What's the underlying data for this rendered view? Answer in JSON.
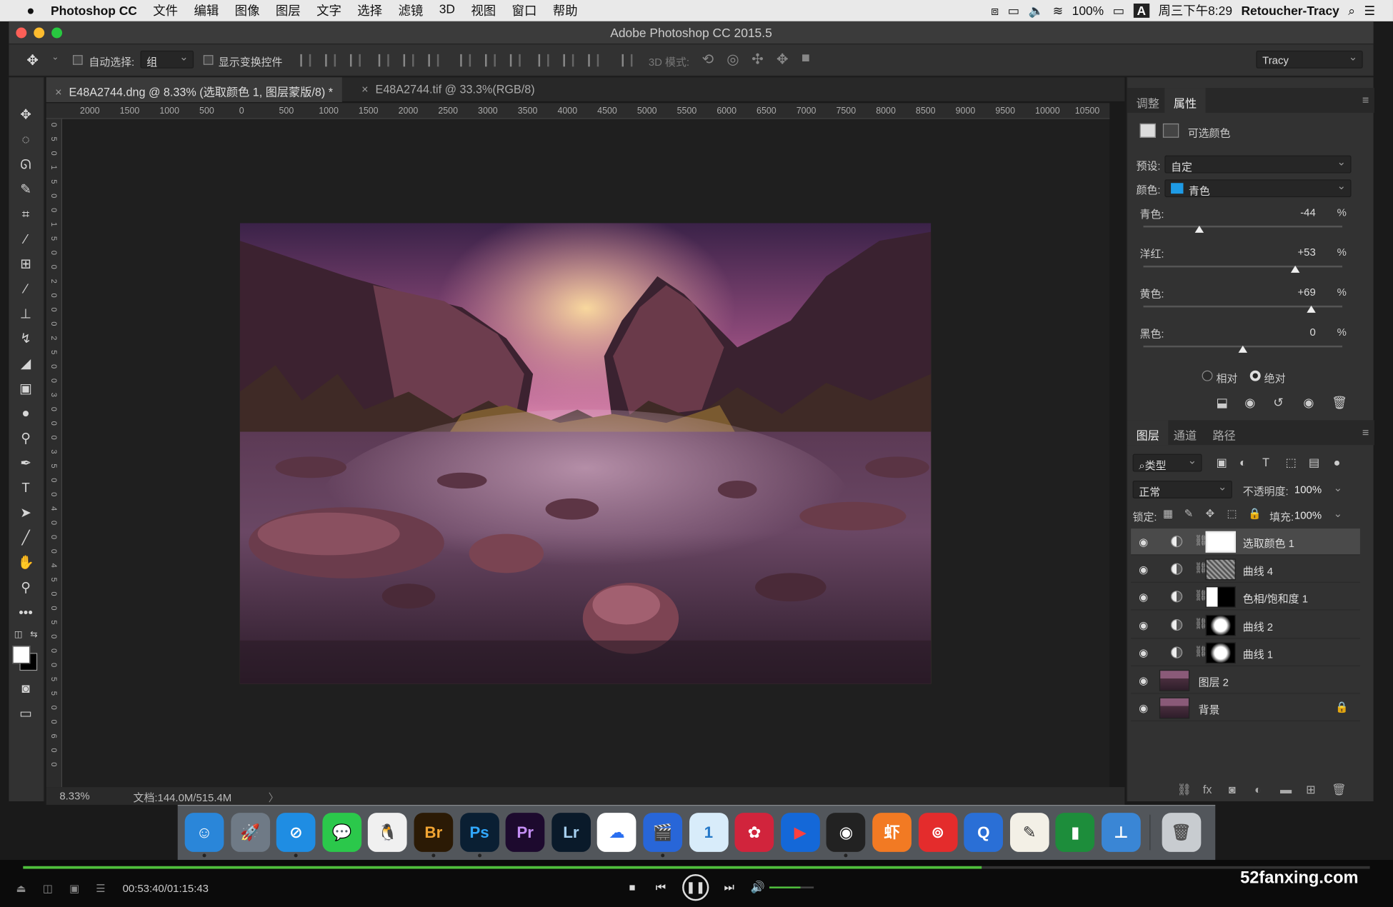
{
  "menubar": {
    "app": "Photoshop CC",
    "items": [
      "文件",
      "编辑",
      "图像",
      "图层",
      "文字",
      "选择",
      "滤镜",
      "3D",
      "视图",
      "窗口",
      "帮助"
    ],
    "battery": "100%",
    "clock": "周三下午8:29",
    "user": "Retoucher-Tracy",
    "input_method": "A"
  },
  "window": {
    "title": "Adobe Photoshop CC 2015.5"
  },
  "options": {
    "auto_select_label": "自动选择:",
    "auto_select_value": "组",
    "show_transform_label": "显示变换控件",
    "mode_3d_label": "3D 模式:",
    "workspace": "Tracy"
  },
  "tabs": [
    {
      "label": "E48A2744.dng @ 8.33% (选取颜色 1, 图层蒙版/8) *",
      "active": true
    },
    {
      "label": "E48A2744.tif @ 33.3%(RGB/8)",
      "active": false
    }
  ],
  "ruler": {
    "top": [
      "2000",
      "1500",
      "1000",
      "500",
      "0",
      "500",
      "1000",
      "1500",
      "2000",
      "2500",
      "3000",
      "3500",
      "4000",
      "4500",
      "5000",
      "5500",
      "6000",
      "6500",
      "7000",
      "7500",
      "8000",
      "8500",
      "9000",
      "9500",
      "10000",
      "10500"
    ],
    "left": [
      "0",
      "5",
      "0",
      "1",
      "5",
      "0",
      "0",
      "1",
      "5",
      "0",
      "0",
      "2",
      "0",
      "0",
      "0",
      "2",
      "5",
      "0",
      "0",
      "3",
      "0",
      "0",
      "0",
      "3",
      "5",
      "0",
      "0",
      "4",
      "0",
      "0",
      "0",
      "4",
      "5",
      "0",
      "0",
      "5",
      "0",
      "0",
      "0",
      "5",
      "5",
      "0",
      "0",
      "6",
      "0",
      "0"
    ]
  },
  "status": {
    "zoom": "8.33%",
    "doc": "文档:144.0M/515.4M",
    "arrow": "〉"
  },
  "properties": {
    "tabs": [
      "调整",
      "属性"
    ],
    "header": "可选颜色",
    "preset_label": "预设:",
    "preset_value": "自定",
    "color_label": "颜色:",
    "color_value": "青色",
    "color_swatch": "#1e9be6",
    "sliders": [
      {
        "label": "青色:",
        "value": "-44",
        "unit": "%",
        "fraction": 0.28
      },
      {
        "label": "洋红:",
        "value": "+53",
        "unit": "%",
        "fraction": 0.765
      },
      {
        "label": "黄色:",
        "value": "+69",
        "unit": "%",
        "fraction": 0.845
      },
      {
        "label": "黑色:",
        "value": "0",
        "unit": "%",
        "fraction": 0.5
      }
    ],
    "method_relative": "相对",
    "method_absolute": "绝对",
    "method_selected": "absolute"
  },
  "layers_panel": {
    "tabs": [
      "图层",
      "通道",
      "路径"
    ],
    "filter_label": "类型",
    "blend_mode": "正常",
    "opacity_label": "不透明度:",
    "opacity_value": "100%",
    "lock_label": "锁定:",
    "fill_label": "填充:",
    "fill_value": "100%",
    "layers": [
      {
        "name": "选取颜色 1",
        "kind": "adjustment",
        "mask": "white",
        "selected": true
      },
      {
        "name": "曲线 4",
        "kind": "adjustment",
        "mask": "noise",
        "selected": false
      },
      {
        "name": "色相/饱和度 1",
        "kind": "adjustment",
        "mask": "half",
        "selected": false
      },
      {
        "name": "曲线 2",
        "kind": "adjustment",
        "mask": "spot",
        "selected": false
      },
      {
        "name": "曲线 1",
        "kind": "adjustment",
        "mask": "spot",
        "selected": false
      },
      {
        "name": "图层 2",
        "kind": "pixel",
        "mask": "",
        "selected": false
      },
      {
        "name": "背景",
        "kind": "background",
        "mask": "",
        "selected": false
      }
    ],
    "footer_icons": [
      "link-icon",
      "fx-icon",
      "mask-icon",
      "adjustment-icon",
      "folder-icon",
      "new-layer-icon",
      "trash-icon"
    ]
  },
  "dock": {
    "apps": [
      {
        "name": "finder",
        "glyph": "☺",
        "bg": "#2a86d9",
        "fg": "#ffffff"
      },
      {
        "name": "launchpad",
        "glyph": "🚀",
        "bg": "#6f7a86",
        "fg": "#ffffff"
      },
      {
        "name": "safari",
        "glyph": "⊘",
        "bg": "#1f8de3",
        "fg": "#ffffff"
      },
      {
        "name": "wechat",
        "glyph": "💬",
        "bg": "#2bc84b",
        "fg": "#ffffff"
      },
      {
        "name": "qq",
        "glyph": "🐧",
        "bg": "#f0f0f0",
        "fg": "#111111"
      },
      {
        "name": "bridge",
        "glyph": "Br",
        "bg": "#2b1a05",
        "fg": "#f2a533"
      },
      {
        "name": "photoshop",
        "glyph": "Ps",
        "bg": "#0a1f33",
        "fg": "#31a8ff"
      },
      {
        "name": "premiere",
        "glyph": "Pr",
        "bg": "#1d0a2e",
        "fg": "#c48ef4"
      },
      {
        "name": "lightroom",
        "glyph": "Lr",
        "bg": "#0a1a2a",
        "fg": "#a6d0f0"
      },
      {
        "name": "baidu-cloud",
        "glyph": "☁",
        "bg": "#ffffff",
        "fg": "#2a6ff0"
      },
      {
        "name": "video-app",
        "glyph": "🎬",
        "bg": "#2866d8",
        "fg": "#ffffff"
      },
      {
        "name": "1password",
        "glyph": "1",
        "bg": "#d8ecfa",
        "fg": "#2478c8"
      },
      {
        "name": "davinci",
        "glyph": "✿",
        "bg": "#d1243c",
        "fg": "#ffffff"
      },
      {
        "name": "player-app",
        "glyph": "▶",
        "bg": "#1468d8",
        "fg": "#ff4040"
      },
      {
        "name": "obs",
        "glyph": "◉",
        "bg": "#222222",
        "fg": "#ffffff"
      },
      {
        "name": "xiami",
        "glyph": "虾",
        "bg": "#f27a23",
        "fg": "#ffffff"
      },
      {
        "name": "netease-music",
        "glyph": "⊚",
        "bg": "#e42c2c",
        "fg": "#ffffff"
      },
      {
        "name": "quicktime",
        "glyph": "Q",
        "bg": "#2a6fd6",
        "fg": "#ffffff"
      },
      {
        "name": "textedit",
        "glyph": "✎",
        "bg": "#f3f0e6",
        "fg": "#333333"
      },
      {
        "name": "numbers",
        "glyph": "▮",
        "bg": "#1d8d3b",
        "fg": "#ffffff"
      },
      {
        "name": "keynote",
        "glyph": "⊥",
        "bg": "#3a86d5",
        "fg": "#ffffff"
      },
      {
        "name": "trash",
        "glyph": "🗑",
        "bg": "#c8ccd0",
        "fg": "#555555"
      }
    ]
  },
  "player": {
    "time": "00:53:40/01:15:43",
    "progress": 0.712,
    "volume": 0.7,
    "watermark": "52fanxing.com"
  }
}
